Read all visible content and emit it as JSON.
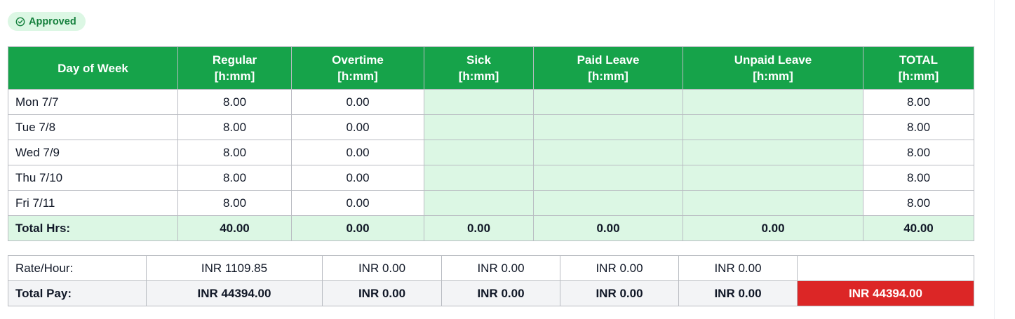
{
  "status": {
    "label": "Approved",
    "color": "#15803d",
    "background": "#dcf7e4",
    "icon": "check-circle-icon"
  },
  "colors": {
    "header": "#16a34a",
    "empty_cell": "#dcf7e4",
    "grand_total": "#dc2626"
  },
  "hours_table": {
    "headers": [
      {
        "name": "Day of Week",
        "unit": ""
      },
      {
        "name": "Regular",
        "unit": "[h:mm]"
      },
      {
        "name": "Overtime",
        "unit": "[h:mm]"
      },
      {
        "name": "Sick",
        "unit": "[h:mm]"
      },
      {
        "name": "Paid Leave",
        "unit": "[h:mm]"
      },
      {
        "name": "Unpaid Leave",
        "unit": "[h:mm]"
      },
      {
        "name": "TOTAL",
        "unit": "[h:mm]"
      }
    ],
    "rows": [
      {
        "day": "Mon 7/7",
        "regular": "8.00",
        "overtime": "0.00",
        "sick": "",
        "paid_leave": "",
        "unpaid_leave": "",
        "total": "8.00"
      },
      {
        "day": "Tue 7/8",
        "regular": "8.00",
        "overtime": "0.00",
        "sick": "",
        "paid_leave": "",
        "unpaid_leave": "",
        "total": "8.00"
      },
      {
        "day": "Wed 7/9",
        "regular": "8.00",
        "overtime": "0.00",
        "sick": "",
        "paid_leave": "",
        "unpaid_leave": "",
        "total": "8.00"
      },
      {
        "day": "Thu 7/10",
        "regular": "8.00",
        "overtime": "0.00",
        "sick": "",
        "paid_leave": "",
        "unpaid_leave": "",
        "total": "8.00"
      },
      {
        "day": "Fri 7/11",
        "regular": "8.00",
        "overtime": "0.00",
        "sick": "",
        "paid_leave": "",
        "unpaid_leave": "",
        "total": "8.00"
      }
    ],
    "totals": {
      "label": "Total Hrs:",
      "regular": "40.00",
      "overtime": "0.00",
      "sick": "0.00",
      "paid_leave": "0.00",
      "unpaid_leave": "0.00",
      "total": "40.00"
    }
  },
  "pay_table": {
    "rate": {
      "label": "Rate/Hour:",
      "regular": "INR 1109.85",
      "overtime": "INR 0.00",
      "sick": "INR 0.00",
      "paid_leave": "INR 0.00",
      "unpaid_leave": "INR 0.00",
      "total": ""
    },
    "total_pay": {
      "label": "Total Pay:",
      "regular": "INR 44394.00",
      "overtime": "INR 0.00",
      "sick": "INR 0.00",
      "paid_leave": "INR 0.00",
      "unpaid_leave": "INR 0.00",
      "total": "INR 44394.00"
    }
  }
}
